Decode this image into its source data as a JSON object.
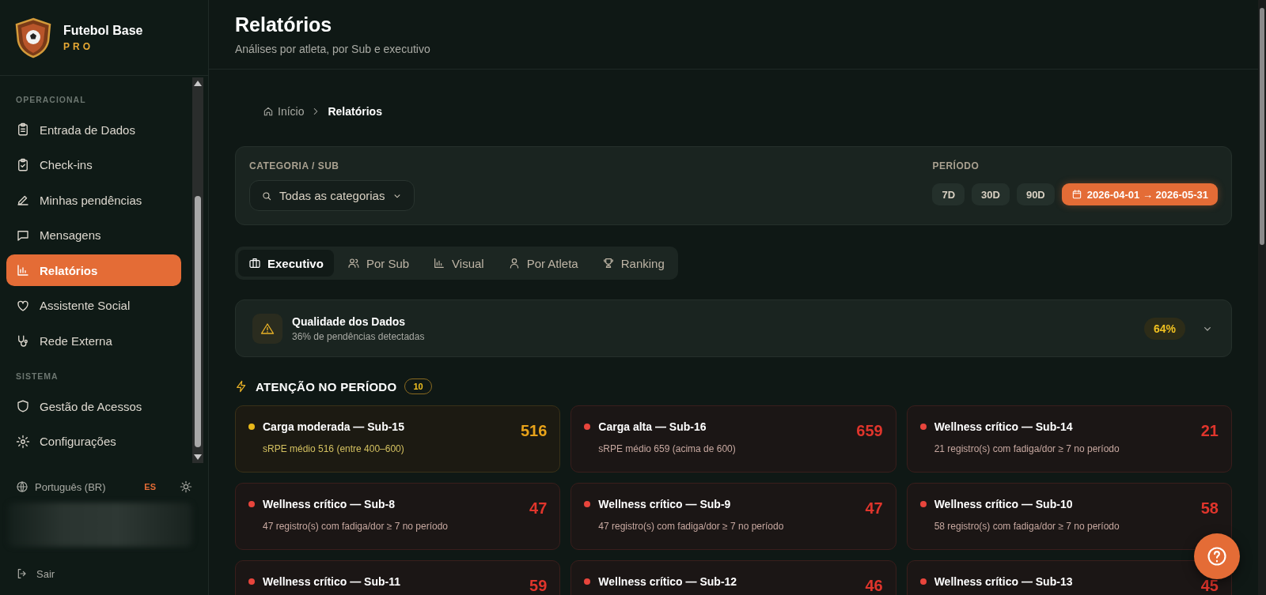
{
  "brand": {
    "name": "Futebol Base",
    "tier": "PRO"
  },
  "sidebar": {
    "sections": [
      {
        "title": "OPERACIONAL",
        "items": [
          {
            "label": "Entrada de Dados",
            "kind": "clipboard-list",
            "selected": false
          },
          {
            "label": "Check-ins",
            "kind": "clipboard-check",
            "selected": false
          },
          {
            "label": "Minhas pendências",
            "kind": "pencil",
            "selected": false
          },
          {
            "label": "Mensagens",
            "kind": "message",
            "selected": false
          },
          {
            "label": "Relatórios",
            "kind": "chart",
            "selected": true
          },
          {
            "label": "Assistente Social",
            "kind": "heart",
            "selected": false
          },
          {
            "label": "Rede Externa",
            "kind": "stethoscope",
            "selected": false
          }
        ]
      },
      {
        "title": "SISTEMA",
        "items": [
          {
            "label": "Gestão de Acessos",
            "kind": "shield",
            "selected": false
          },
          {
            "label": "Configurações",
            "kind": "gear",
            "selected": false
          }
        ]
      }
    ]
  },
  "language": {
    "current": "Português (BR)",
    "alternate": {
      "label": "ES",
      "highlighted": true
    }
  },
  "logout": "Sair",
  "header": {
    "title": "Relatórios",
    "subtitle": "Análises por atleta, por Sub e executivo"
  },
  "breadcrumb": [
    {
      "label": "Início",
      "kind": "home"
    },
    {
      "label": "Relatórios",
      "kind": "current"
    }
  ],
  "filters": {
    "category_label": "CATEGORIA / SUB",
    "category_value": "Todas as categorias",
    "period_label": "PERÍODO",
    "periods": [
      {
        "label": "7D",
        "selected": false,
        "kind": "preset"
      },
      {
        "label": "30D",
        "selected": false,
        "kind": "preset"
      },
      {
        "label": "90D",
        "selected": false,
        "kind": "preset"
      },
      {
        "label": "2026-04-01 → 2026-05-31",
        "selected": true,
        "kind": "range"
      }
    ]
  },
  "tabs": [
    {
      "label": "Executivo",
      "kind": "briefcase",
      "selected": true
    },
    {
      "label": "Por Sub",
      "kind": "users",
      "selected": false
    },
    {
      "label": "Visual",
      "kind": "chart",
      "selected": false
    },
    {
      "label": "Por Atleta",
      "kind": "user",
      "selected": false
    },
    {
      "label": "Ranking",
      "kind": "trophy",
      "selected": false
    }
  ],
  "quality": {
    "title": "Qualidade dos Dados",
    "subtitle": "36% de pendências detectadas",
    "score": "64%",
    "expanded": false
  },
  "attention": {
    "title": "ATENÇÃO NO PERÍODO",
    "count": "10",
    "alerts": [
      {
        "title": "Carga moderada — Sub-15",
        "detail": "sRPE médio 516 (entre 400–600)",
        "value": "516",
        "kind": "warning"
      },
      {
        "title": "Carga alta — Sub-16",
        "detail": "sRPE médio 659 (acima de 600)",
        "value": "659",
        "kind": "critical"
      },
      {
        "title": "Wellness crítico — Sub-14",
        "detail": "21 registro(s) com fadiga/dor ≥ 7 no período",
        "value": "21",
        "kind": "critical"
      },
      {
        "title": "Wellness crítico — Sub-8",
        "detail": "47 registro(s) com fadiga/dor ≥ 7 no período",
        "value": "47",
        "kind": "critical"
      },
      {
        "title": "Wellness crítico — Sub-9",
        "detail": "47 registro(s) com fadiga/dor ≥ 7 no período",
        "value": "47",
        "kind": "critical"
      },
      {
        "title": "Wellness crítico — Sub-10",
        "detail": "58 registro(s) com fadiga/dor ≥ 7 no período",
        "value": "58",
        "kind": "critical"
      },
      {
        "title": "Wellness crítico — Sub-11",
        "value": "59",
        "kind": "critical"
      },
      {
        "title": "Wellness crítico — Sub-12",
        "value": "46",
        "kind": "critical"
      },
      {
        "title": "Wellness crítico — Sub-13",
        "value": "45",
        "kind": "critical"
      }
    ]
  }
}
